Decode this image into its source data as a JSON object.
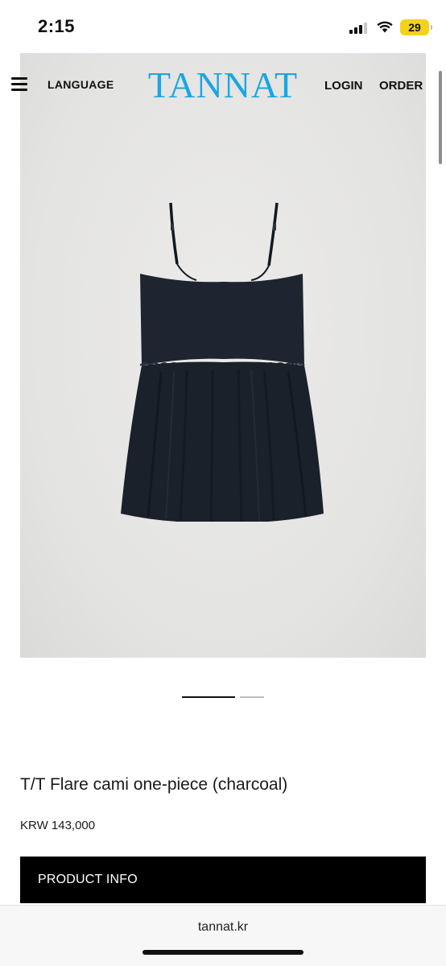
{
  "status_bar": {
    "time": "2:15",
    "battery": "29",
    "icons": [
      "signal-icon",
      "wifi-icon",
      "battery-icon"
    ]
  },
  "header": {
    "menu_icon": "hamburger-menu-icon",
    "language_label": "LANGUAGE",
    "logo_text": "TANNAT",
    "login_label": "LOGIN",
    "order_label": "ORDER",
    "logo_color": "#1aa6e2"
  },
  "gallery": {
    "image_count": 2,
    "active_index": 0
  },
  "product": {
    "title": "T/T Flare cami one-piece (charcoal)",
    "price": "KRW 143,000",
    "info_label": "PRODUCT INFO"
  },
  "browser": {
    "url": "tannat.kr"
  },
  "colors": {
    "accent": "#1aa6e2",
    "bar": "#000000",
    "garment": "#1e2530"
  }
}
